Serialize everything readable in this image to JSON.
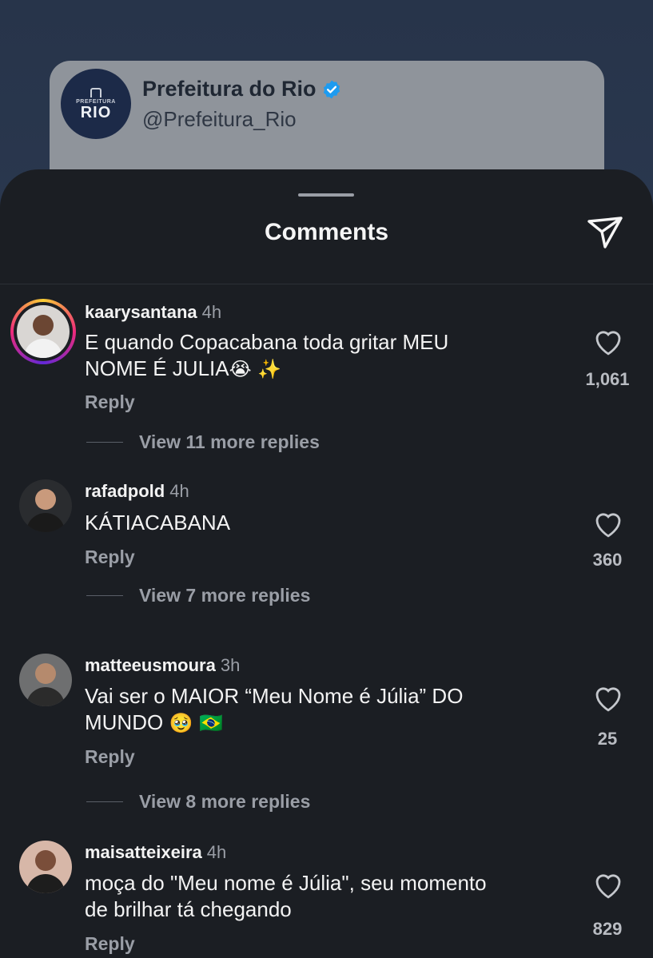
{
  "post": {
    "avatar_small": "PREFEITURA",
    "avatar_big": "RIO",
    "name": "Prefeitura do Rio",
    "handle": "@Prefeitura_Rio"
  },
  "sheet": {
    "title": "Comments"
  },
  "comments": [
    {
      "username": "kaarysantana",
      "time": "4h",
      "text_line1": "E quando Copacabana toda gritar MEU",
      "text_line2": "NOME É JULIA",
      "emoji": "😭 ✨",
      "reply": "Reply",
      "likes": "1,061",
      "view_replies": "View 11 more replies"
    },
    {
      "username": "rafadpold",
      "time": "4h",
      "text_line1": "KÁTIACABANA",
      "reply": "Reply",
      "likes": "360",
      "view_replies": "View 7 more replies"
    },
    {
      "username": "matteeusmoura",
      "time": "3h",
      "text_line1": "Vai ser o MAIOR “Meu Nome é Júlia” DO",
      "text_line2": "MUNDO",
      "emoji": "🥹 🇧🇷",
      "reply": "Reply",
      "likes": "25",
      "view_replies": "View 8 more replies"
    },
    {
      "username": "maisatteixeira",
      "time": "4h",
      "text_line1": "moça do \"Meu nome é Júlia\", seu momento",
      "text_line2": "de brilhar tá chegando",
      "reply": "Reply",
      "likes": "829"
    }
  ],
  "colors": {
    "sheet_bg": "#1b1e23",
    "verified": "#1d9bf0",
    "muted_text": "#9a9ea6"
  }
}
